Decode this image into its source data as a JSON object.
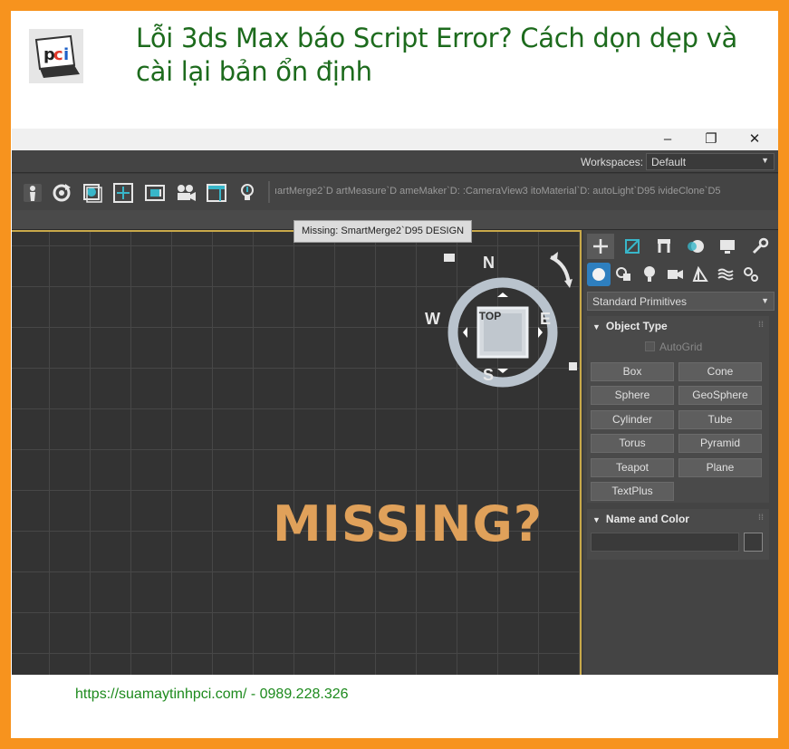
{
  "article": {
    "logo_text": "pci",
    "headline": "Lỗi 3ds Max báo Script Error? Cách dọn dẹp và cài lại bản ổn định",
    "footer": "https://suamaytinhpci.com/ - 0989.228.326"
  },
  "window": {
    "minimize_icon": "minimize-icon",
    "restore_icon": "restore-icon",
    "close_icon": "close-icon",
    "minimize_glyph": "–",
    "restore_glyph": "❐",
    "close_glyph": "✕"
  },
  "workspace": {
    "label": "Workspaces:",
    "value": "Default"
  },
  "toolbar": {
    "icons": [
      "figure-icon",
      "refresh-icon",
      "material-icon",
      "frame-icon",
      "film-icon",
      "camera-icon",
      "window-icon",
      "light-icon"
    ],
    "scripts_text": "ıartMerge2`D artMeasure`D ameMaker`D: :CameraView3 itoMaterial`D: autoLight`D95 ivideClone`D5"
  },
  "viewport": {
    "tooltip": "Missing: SmartMerge2`D95 DESIGN",
    "viewcube": {
      "face": "TOP",
      "north": "N",
      "south": "S",
      "east": "E",
      "west": "W"
    },
    "overlay_text": "MISSING?"
  },
  "command_panel": {
    "tabs": [
      "create-icon",
      "modify-icon",
      "hierarchy-icon",
      "motion-icon",
      "display-icon",
      "utilities-icon"
    ],
    "categories": [
      "geometry-icon",
      "shapes-icon",
      "lights-icon",
      "cameras-icon",
      "helpers-icon",
      "spacewarps-icon",
      "systems-icon"
    ],
    "dropdown": "Standard Primitives",
    "object_type": {
      "title": "Object Type",
      "autogrid": "AutoGrid",
      "buttons": [
        "Box",
        "Cone",
        "Sphere",
        "GeoSphere",
        "Cylinder",
        "Tube",
        "Torus",
        "Pyramid",
        "Teapot",
        "Plane",
        "TextPlus"
      ]
    },
    "name_color": {
      "title": "Name and Color",
      "name_value": ""
    }
  },
  "colors": {
    "border": "#f7931e",
    "headline": "#1d6b1d",
    "overlay": "#e0a15a",
    "viewport_frame": "#c9a94a"
  }
}
